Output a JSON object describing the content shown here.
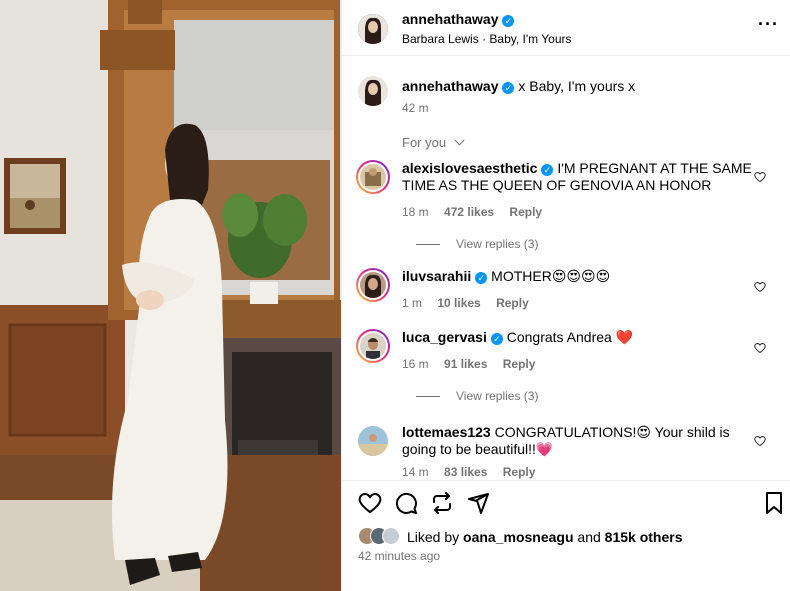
{
  "post": {
    "author": "annehathaway",
    "audio_artist": "Barbara Lewis",
    "audio_sep": "·",
    "audio_title": "Baby, I'm Yours",
    "caption_author": "annehathaway",
    "caption": "x Baby, I'm yours x",
    "caption_time": "42 m",
    "for_you": "For you"
  },
  "comments": [
    {
      "user": "alexislovesaesthetic",
      "text": "I'M PREGNANT AT THE SAME TIME AS THE QUEEN OF GENOVIA AN HONOR",
      "time": "18 m",
      "likes": "472 likes",
      "reply": "Reply",
      "view_replies": "View replies (3)",
      "verified": true
    },
    {
      "user": "iluvsarahii",
      "text": "MOTHER😍😍😍😍",
      "time": "1 m",
      "likes": "10 likes",
      "reply": "Reply",
      "verified": true
    },
    {
      "user": "luca_gervasi",
      "text": "Congrats Andrea ❤️",
      "time": "16 m",
      "likes": "91 likes",
      "reply": "Reply",
      "view_replies": "View replies (3)",
      "verified": true
    },
    {
      "user": "lottemaes123",
      "text": "CONGRATULATIONS!😍 Your shild is going to be beautiful!!💗",
      "time": "14 m",
      "likes": "83 likes",
      "reply": "Reply",
      "verified": false
    }
  ],
  "likes": {
    "prefix": "Liked by",
    "user": "oana_mosneagu",
    "and": "and",
    "others": "815k others",
    "time": "42 minutes ago"
  },
  "colors": {
    "verified": "#0095f6",
    "secondary_text": "#737373",
    "heart_red": "#ed4956"
  },
  "icons": [
    "heart-icon",
    "comment-icon",
    "share-icon",
    "send-icon",
    "bookmark-icon",
    "more-icon",
    "chevron-down-icon"
  ]
}
